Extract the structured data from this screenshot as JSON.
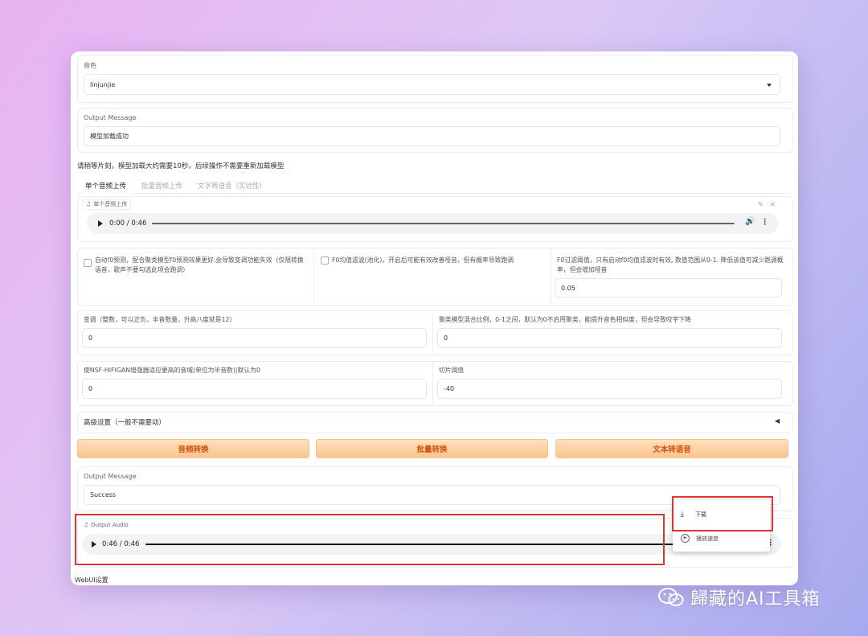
{
  "voice": {
    "label": "音色",
    "selected": "linjunjie"
  },
  "output_message_top": {
    "label": "Output Message",
    "value": "模型加载成功"
  },
  "notice": "请稍等片刻，模型加载大约需要10秒。后续操作不需要重新加载模型",
  "tabs": [
    "单个音频上传",
    "批量音频上传",
    "文字转语音（实验性）"
  ],
  "upload": {
    "label": "单个音频上传",
    "time": "0:00 / 0:46"
  },
  "options": {
    "auto_f0": "自动f0预测，配合聚类模型f0预测效果更好,会导致变调功能失效（仅限转换语音，歌声不要勾选此项会跑调）",
    "f0_filter": "F0均值滤波(池化)，开启后可能有效改善哑音，但有概率导致跑调",
    "f0_threshold_label": "F0过滤阈值，只有启动f0均值滤波时有效, 数值范围从0-1. 降低该值可减少跑调概率，但会增加哑音",
    "f0_threshold_value": "0.05"
  },
  "transpose": {
    "label": "变调（整数，可以正负，半音数量，升高八度就是12）",
    "value": "0"
  },
  "cluster_ratio": {
    "label": "聚类模型混合比例，0-1之间，默认为0不启用聚类，能提升音色相似度，但会导致咬字下降",
    "value": "0"
  },
  "nsf_range": {
    "label": "使NSF-HIFIGAN增强器适应更高的音域(单位为半音数)|默认为0",
    "value": "0"
  },
  "slice_db": {
    "label": "切片阈值",
    "value": "-40"
  },
  "advanced": {
    "label": "高级设置（一般不需要动）",
    "arrow": "◀"
  },
  "buttons": [
    "音频转换",
    "批量转换",
    "文本转语音"
  ],
  "output_message_bottom": {
    "label": "Output Message",
    "value": "Success"
  },
  "output_audio": {
    "label": "Output Audio",
    "time": "0:46 / 0:46"
  },
  "context_menu": {
    "download": "下载",
    "playback_speed": "播放速度"
  },
  "footer": "WebUI设置",
  "watermark": "歸藏的AI工具箱",
  "colors": {
    "button_text": "#d4520e",
    "highlight_red": "#e03434"
  }
}
